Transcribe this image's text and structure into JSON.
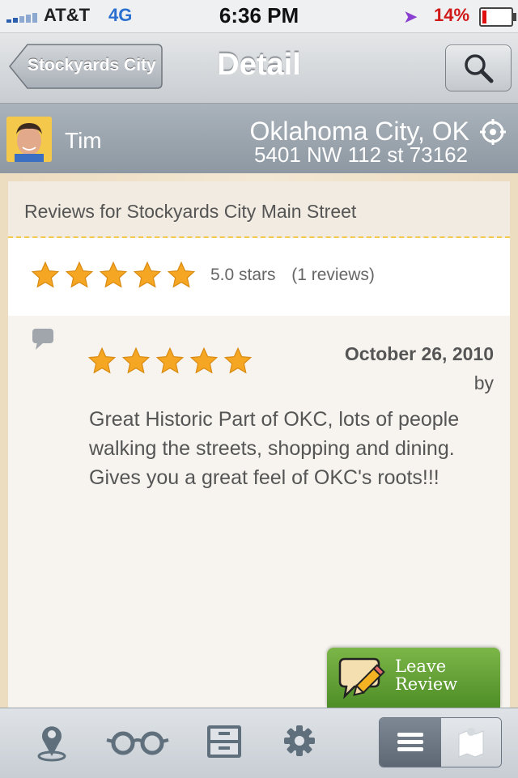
{
  "status_bar": {
    "carrier": "AT&T",
    "network": "4G",
    "time": "6:36 PM",
    "battery": "14%",
    "battery_level": 0.14
  },
  "nav": {
    "back_label": "Stockyards City Main Street",
    "title": "Detail"
  },
  "user": {
    "name": "Tim",
    "city": "Oklahoma City, OK",
    "address": "5401 NW 112 st 73162"
  },
  "reviews_header": "Reviews for Stockyards City Main Street",
  "summary": {
    "stars": 5,
    "rating_text": "5.0 stars",
    "count_text": "(1 reviews)"
  },
  "review": {
    "stars": 5,
    "date": "October 26, 2010",
    "by": "by",
    "text": "Great Historic Part of OKC, lots of people walking the streets, shopping and dining. Gives you a great feel of OKC's roots!!!"
  },
  "leave_review": {
    "line1": "Leave",
    "line2": "Review"
  },
  "tabbar": {
    "icons": [
      "location-pin-icon",
      "glasses-icon",
      "file-cabinet-icon",
      "gear-icon"
    ],
    "segment": [
      "list-icon",
      "map-icon"
    ],
    "selected_segment": "list"
  },
  "colors": {
    "star": "#f5a623",
    "leave_button": "#5a9a30",
    "header_dash": "#f2c94c"
  }
}
